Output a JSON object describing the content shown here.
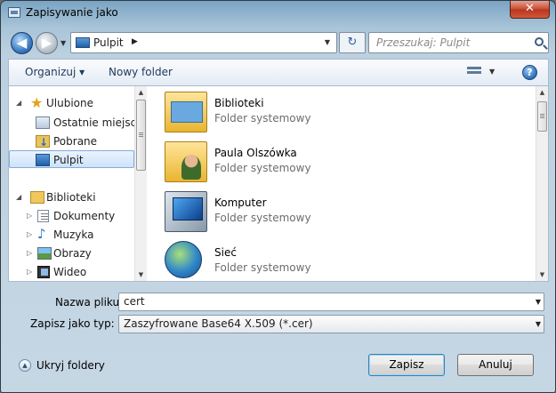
{
  "window": {
    "title": "Zapisywanie jako",
    "close_label": "✕"
  },
  "nav": {
    "back_glyph": "◀",
    "forward_glyph": "▶",
    "address": "Pulpit",
    "address_arrow": "▶",
    "search_placeholder": "Przeszukaj: Pulpit"
  },
  "toolbar": {
    "organize_label": "Organizuj ▾",
    "new_folder_label": "Nowy folder",
    "help_glyph": "?"
  },
  "sidebar": {
    "items": [
      {
        "label": "Ulubione",
        "icon": "star-icon",
        "expander": "◢"
      },
      {
        "label": "Ostatnie miejsca",
        "icon": "recent-places-icon"
      },
      {
        "label": "Pobrane",
        "icon": "downloads-icon"
      },
      {
        "label": "Pulpit",
        "icon": "desktop-icon",
        "selected": true
      },
      {
        "label": "Biblioteki",
        "icon": "libraries-icon",
        "expander": "◢"
      },
      {
        "label": "Dokumenty",
        "icon": "documents-icon",
        "expander": "▷"
      },
      {
        "label": "Muzyka",
        "icon": "music-icon",
        "expander": "▷"
      },
      {
        "label": "Obrazy",
        "icon": "pictures-icon",
        "expander": "▷"
      },
      {
        "label": "Wideo",
        "icon": "video-icon",
        "expander": "▷"
      }
    ]
  },
  "content": {
    "items": [
      {
        "name": "Biblioteki",
        "type": "Folder systemowy",
        "icon": "libraries-icon"
      },
      {
        "name": "Paula Olszówka",
        "type": "Folder systemowy",
        "icon": "user-folder-icon"
      },
      {
        "name": "Komputer",
        "type": "Folder systemowy",
        "icon": "computer-icon"
      },
      {
        "name": "Sieć",
        "type": "Folder systemowy",
        "icon": "network-icon"
      }
    ]
  },
  "form": {
    "filename_label": "Nazwa pliku:",
    "filename_value": "cert",
    "filetype_label": "Zapisz jako typ:",
    "filetype_value": "Zaszyfrowane Base64 X.509 (*.cer)"
  },
  "footer": {
    "hide_folders_label": "Ukryj foldery",
    "save_label": "Zapisz",
    "cancel_label": "Anuluj"
  },
  "colors": {
    "accent": "#3c7fb1",
    "selection": "#cde3fa",
    "title_bar": "#7aa4c4"
  }
}
